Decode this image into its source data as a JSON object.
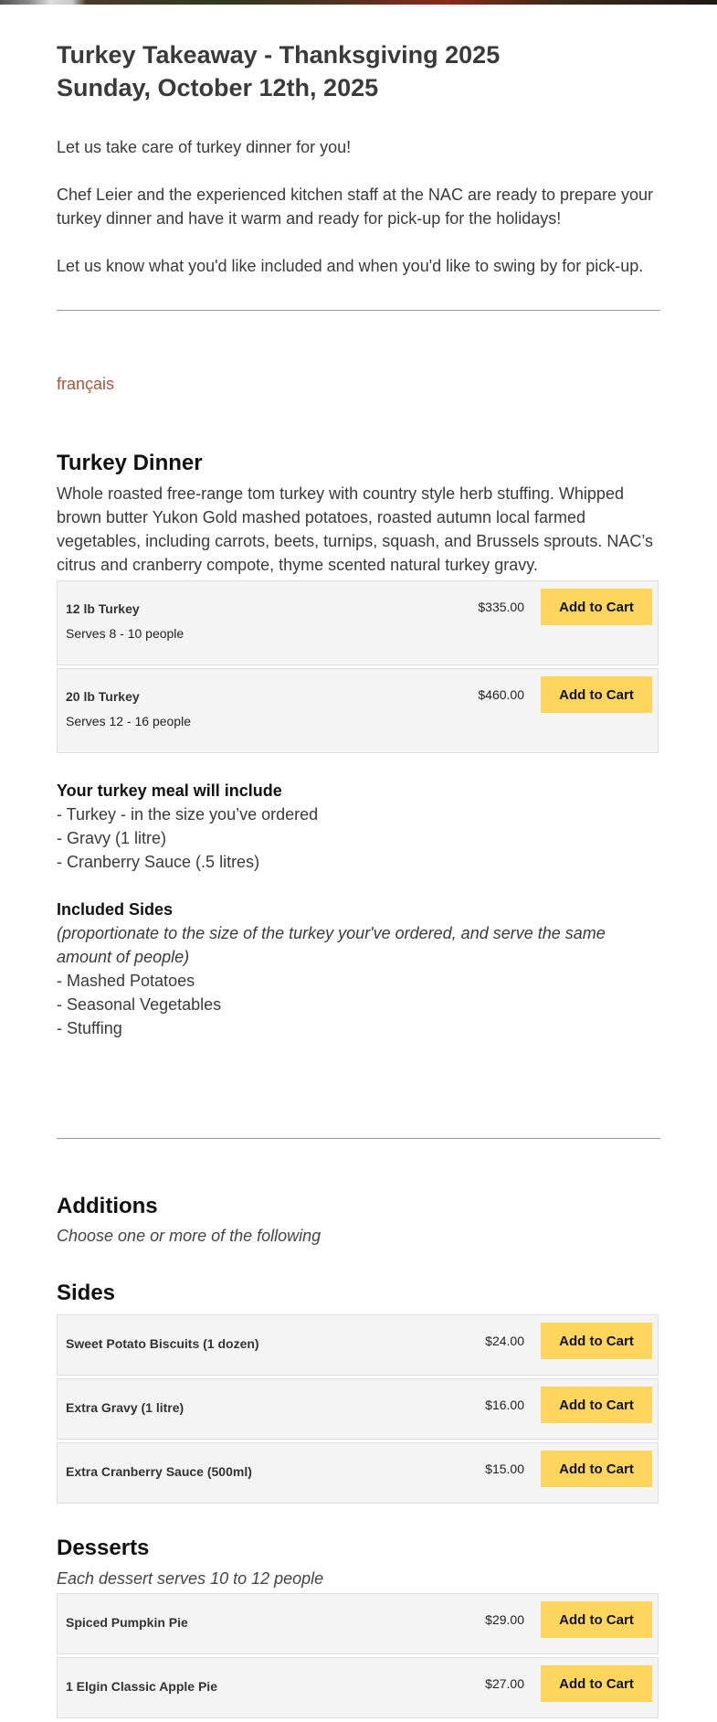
{
  "page": {
    "title_line1": "Turkey Takeaway - Thanksgiving 2025",
    "title_line2": "Sunday, October 12th, 2025",
    "intro": [
      "Let us take care of turkey dinner for you!",
      "Chef Leier and the experienced kitchen staff at the NAC are ready to prepare your turkey dinner and have it warm and ready for pick-up for the holidays!",
      "Let us know what you'd like included and when you'd like to swing by for pick-up."
    ],
    "language_link": "français"
  },
  "turkey_dinner": {
    "heading": "Turkey Dinner",
    "description": "Whole roasted free-range tom turkey with country style herb stuffing. Whipped brown butter Yukon Gold mashed potatoes, roasted autumn local farmed vegetables, including carrots, beets, turnips, squash, and Brussels sprouts. NAC’s citrus and cranberry compote, thyme scented natural turkey gravy.",
    "products": [
      {
        "name": "12 lb Turkey",
        "serves": "Serves 8 - 10 people",
        "price": "$335.00",
        "button": "Add to Cart"
      },
      {
        "name": "20 lb Turkey",
        "serves": "Serves 12 - 16 people",
        "price": "$460.00",
        "button": "Add to Cart"
      }
    ]
  },
  "includes": {
    "heading": "Your turkey meal will include",
    "items": [
      "- Turkey - in the size you’ve ordered",
      "- Gravy (1 litre)",
      "- Cranberry Sauce (.5 litres)"
    ],
    "sides_heading": "Included Sides",
    "sides_note": "(proportionate to the size of the turkey your've ordered, and serve the same amount of people)",
    "sides_items": [
      "- Mashed Potatoes",
      "- Seasonal Vegetables",
      "- Stuffing"
    ]
  },
  "additions": {
    "heading": "Additions",
    "subheading": "Choose one or more of the following"
  },
  "sides": {
    "heading": "Sides",
    "products": [
      {
        "name": "Sweet Potato Biscuits (1 dozen)",
        "price": "$24.00",
        "button": "Add to Cart"
      },
      {
        "name": "Extra Gravy (1 litre)",
        "price": "$16.00",
        "button": "Add to Cart"
      },
      {
        "name": "Extra Cranberry Sauce (500ml)",
        "price": "$15.00",
        "button": "Add to Cart"
      }
    ]
  },
  "desserts": {
    "heading": "Desserts",
    "subheading": "Each dessert serves 10 to 12 people",
    "products": [
      {
        "name": "Spiced Pumpkin Pie",
        "price": "$29.00",
        "button": "Add to Cart"
      },
      {
        "name": "1 Elgin Classic Apple Pie",
        "price": "$27.00",
        "button": "Add to Cart"
      }
    ]
  },
  "colors": {
    "cart_button": "#fed65e",
    "link": "#a4573a",
    "product_bg": "#f4f4f4"
  }
}
